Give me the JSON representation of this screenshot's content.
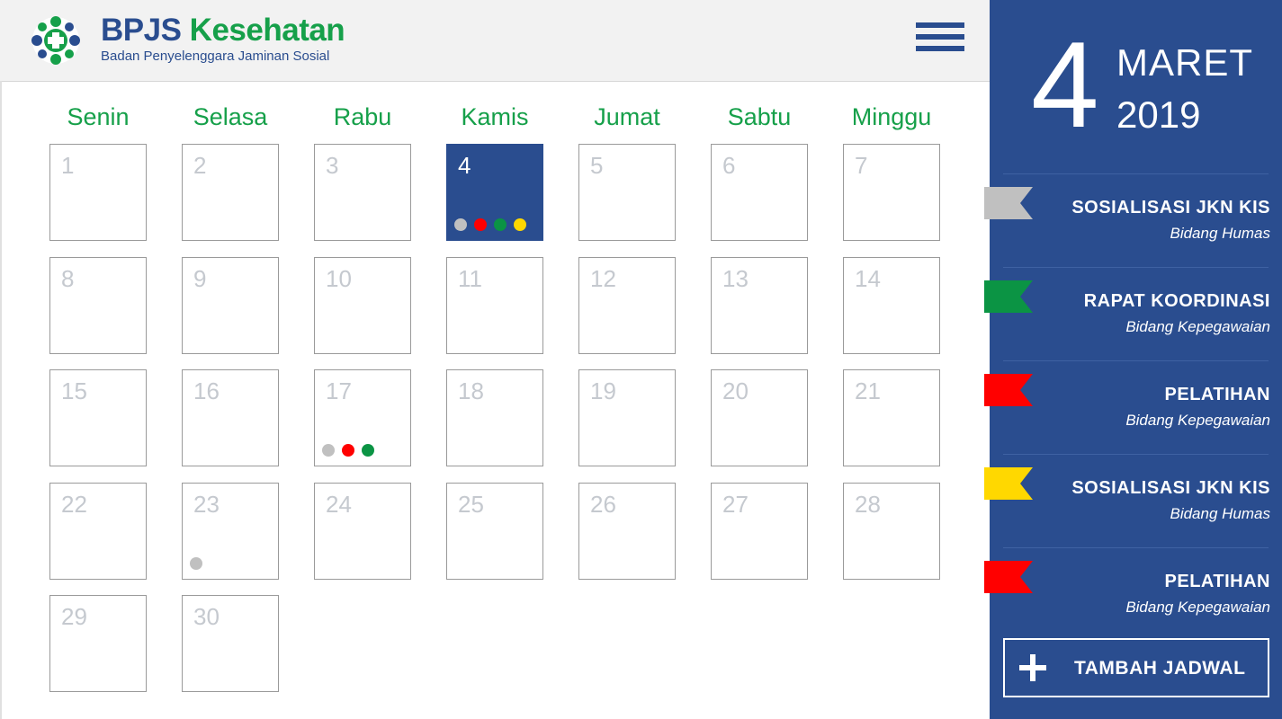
{
  "header": {
    "brand_part1": "BPJS",
    "brand_part2": "Kesehatan",
    "subtitle": "Badan Penyelenggara Jaminan Sosial",
    "menu_icon": "hamburger-menu-icon"
  },
  "colors": {
    "primary_blue": "#2a4d8f",
    "brand_green": "#16a04a",
    "event_gray": "#c0c0c0",
    "event_green": "#0b9444",
    "event_red": "#ff0000",
    "event_yellow": "#ffd800"
  },
  "calendar": {
    "weekdays": [
      "Senin",
      "Selasa",
      "Rabu",
      "Kamis",
      "Jumat",
      "Sabtu",
      "Minggu"
    ],
    "days": [
      {
        "n": "1"
      },
      {
        "n": "2"
      },
      {
        "n": "3"
      },
      {
        "n": "4",
        "today": true,
        "events": [
          "gray",
          "red",
          "green",
          "yellow"
        ]
      },
      {
        "n": "5"
      },
      {
        "n": "6"
      },
      {
        "n": "7"
      },
      {
        "n": "8"
      },
      {
        "n": "9"
      },
      {
        "n": "10"
      },
      {
        "n": "11"
      },
      {
        "n": "12"
      },
      {
        "n": "13"
      },
      {
        "n": "14"
      },
      {
        "n": "15"
      },
      {
        "n": "16"
      },
      {
        "n": "17",
        "events": [
          "gray",
          "red",
          "green"
        ]
      },
      {
        "n": "18"
      },
      {
        "n": "19"
      },
      {
        "n": "20"
      },
      {
        "n": "21"
      },
      {
        "n": "22"
      },
      {
        "n": "23",
        "events": [
          "gray"
        ]
      },
      {
        "n": "24"
      },
      {
        "n": "25"
      },
      {
        "n": "26"
      },
      {
        "n": "27"
      },
      {
        "n": "28"
      },
      {
        "n": "29"
      },
      {
        "n": "30"
      }
    ]
  },
  "sidebar": {
    "day": "4",
    "month": "MARET",
    "year": "2019",
    "events": [
      {
        "title": "SOSIALISASI JKN KIS",
        "dept": "Bidang Humas",
        "color": "gray"
      },
      {
        "title": "RAPAT KOORDINASI",
        "dept": "Bidang Kepegawaian",
        "color": "green"
      },
      {
        "title": "PELATIHAN",
        "dept": "Bidang Kepegawaian",
        "color": "red"
      },
      {
        "title": "SOSIALISASI JKN KIS",
        "dept": "Bidang Humas",
        "color": "yellow"
      },
      {
        "title": "PELATIHAN",
        "dept": "Bidang Kepegawaian",
        "color": "red"
      }
    ],
    "add_label": "TAMBAH JADWAL",
    "add_icon": "plus-icon"
  }
}
